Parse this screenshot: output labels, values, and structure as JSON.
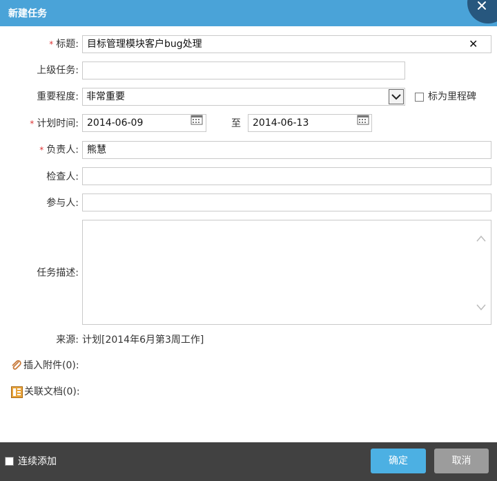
{
  "dialog": {
    "title": "新建任务"
  },
  "form": {
    "required_mark": "*",
    "title_label": "标题:",
    "title_value": "目标管理模块客户bug处理",
    "clear_symbol": "✕",
    "parent_label": "上级任务:",
    "parent_value": "",
    "priority_label": "重要程度:",
    "priority_value": "非常重要",
    "milestone_label": "标为里程碑",
    "plan_time_label": "计划时间:",
    "start_date": "2014-06-09",
    "to_label": "至",
    "end_date": "2014-06-13",
    "owner_label": "负责人:",
    "owner_value": "熊慧",
    "checker_label": "检查人:",
    "checker_value": "",
    "participants_label": "参与人:",
    "participants_value": "",
    "description_label": "任务描述:",
    "description_value": "",
    "source_label": "来源:",
    "source_value": "计划[2014年6月第3周工作]",
    "attachments_label": "插入附件(0):",
    "documents_label": "关联文档(0):"
  },
  "footer": {
    "continuous_add_label": "连续添加",
    "ok_label": "确定",
    "cancel_label": "取消"
  },
  "colors": {
    "titlebar": "#4aa3d8",
    "close_circle": "#27577e",
    "required": "#dd3333",
    "footer": "#414141",
    "ok_button": "#4cb0e3",
    "cancel_button": "#9c9c9c"
  },
  "icons": {
    "close": "close-icon",
    "dropdown": "chevron-down-icon",
    "calendar": "calendar-icon",
    "attachment": "paperclip-icon",
    "document": "document-icon",
    "scroll_up": "chevron-up-icon",
    "scroll_down": "chevron-down-icon"
  }
}
